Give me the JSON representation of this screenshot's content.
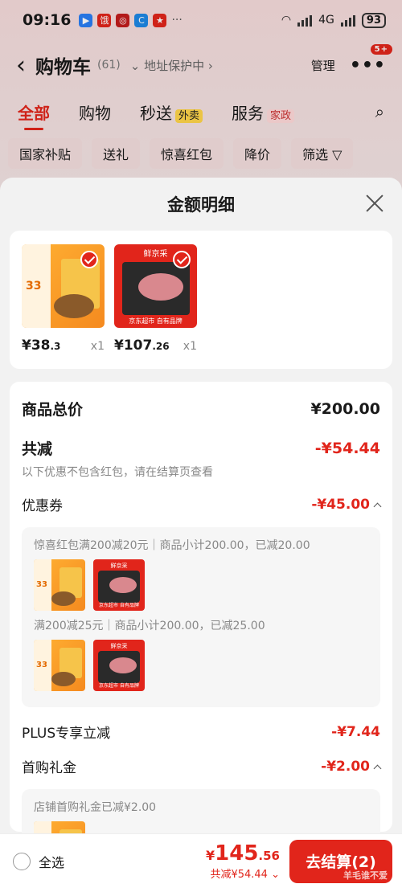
{
  "status_bar": {
    "time": "09:16",
    "battery": "93",
    "network": "4G"
  },
  "header": {
    "title": "购物车",
    "count": "(61)",
    "address_protect": "地址保护中",
    "manage": "管理",
    "badge": "5+"
  },
  "tabs": [
    {
      "label": "全部"
    },
    {
      "label": "购物"
    },
    {
      "label": "秒送",
      "tag": "外卖"
    },
    {
      "label": "服务",
      "tag": "家政"
    }
  ],
  "chips": [
    "国家补贴",
    "送礼",
    "惊喜红包",
    "降价",
    "筛选"
  ],
  "sheet": {
    "title": "金额明细",
    "items": [
      {
        "price_int": "¥38",
        "price_dec": ".3",
        "qty": "x1",
        "art_num": "33"
      },
      {
        "price_int": "¥107",
        "price_dec": ".26",
        "qty": "x1",
        "art_label": "鲜京采",
        "art_foot": "京东超市 自有品牌"
      }
    ],
    "total_label": "商品总价",
    "total_value": "¥200.00",
    "reduce_label": "共减",
    "reduce_value": "-¥54.44",
    "reduce_note": "以下优惠不包含红包，请在结算页查看",
    "coupon_label": "优惠券",
    "coupon_value": "-¥45.00",
    "coupon_lines": [
      "惊喜红包满200减20元｜商品小计200.00，已减20.00",
      "满200减25元｜商品小计200.00，已减25.00"
    ],
    "plus_label": "PLUS专享立减",
    "plus_value": "-¥7.44",
    "first_label": "首购礼金",
    "first_value": "-¥2.00",
    "first_note": "店铺首购礼金已减¥2.00"
  },
  "bottom": {
    "select_all": "全选",
    "currency": "¥",
    "pay_int": "145",
    "pay_dec": ".56",
    "reduced": "共减¥54.44",
    "checkout": "去结算(2)",
    "watermark": "羊毛谁不爱"
  },
  "colors": {
    "accent": "#e1251b",
    "orange": "#f58a1f"
  }
}
